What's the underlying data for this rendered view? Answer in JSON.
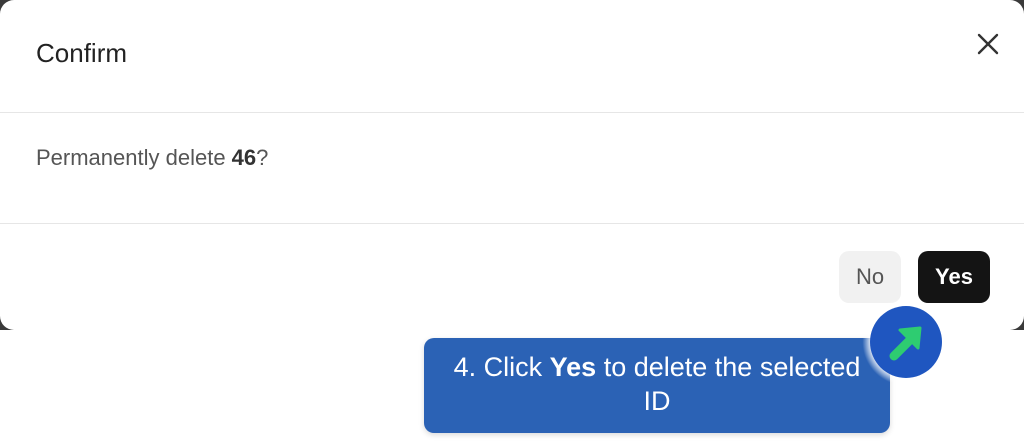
{
  "dialog": {
    "title": "Confirm",
    "message_prefix": "Permanently delete ",
    "message_target": "46",
    "message_suffix": "?",
    "no_label": "No",
    "yes_label": "Yes"
  },
  "callout": {
    "prefix": "4. Click ",
    "emphasis": "Yes",
    "suffix": " to delete the selected ID"
  },
  "icons": {
    "close": "close-icon",
    "pointer": "arrow-up-right-icon"
  },
  "colors": {
    "yes_button": "#141414",
    "no_button": "#f1f1f1",
    "callout": "#2b62b5",
    "pointer_circle": "#1f56c0",
    "pointer_arrow": "#2ecc71"
  }
}
